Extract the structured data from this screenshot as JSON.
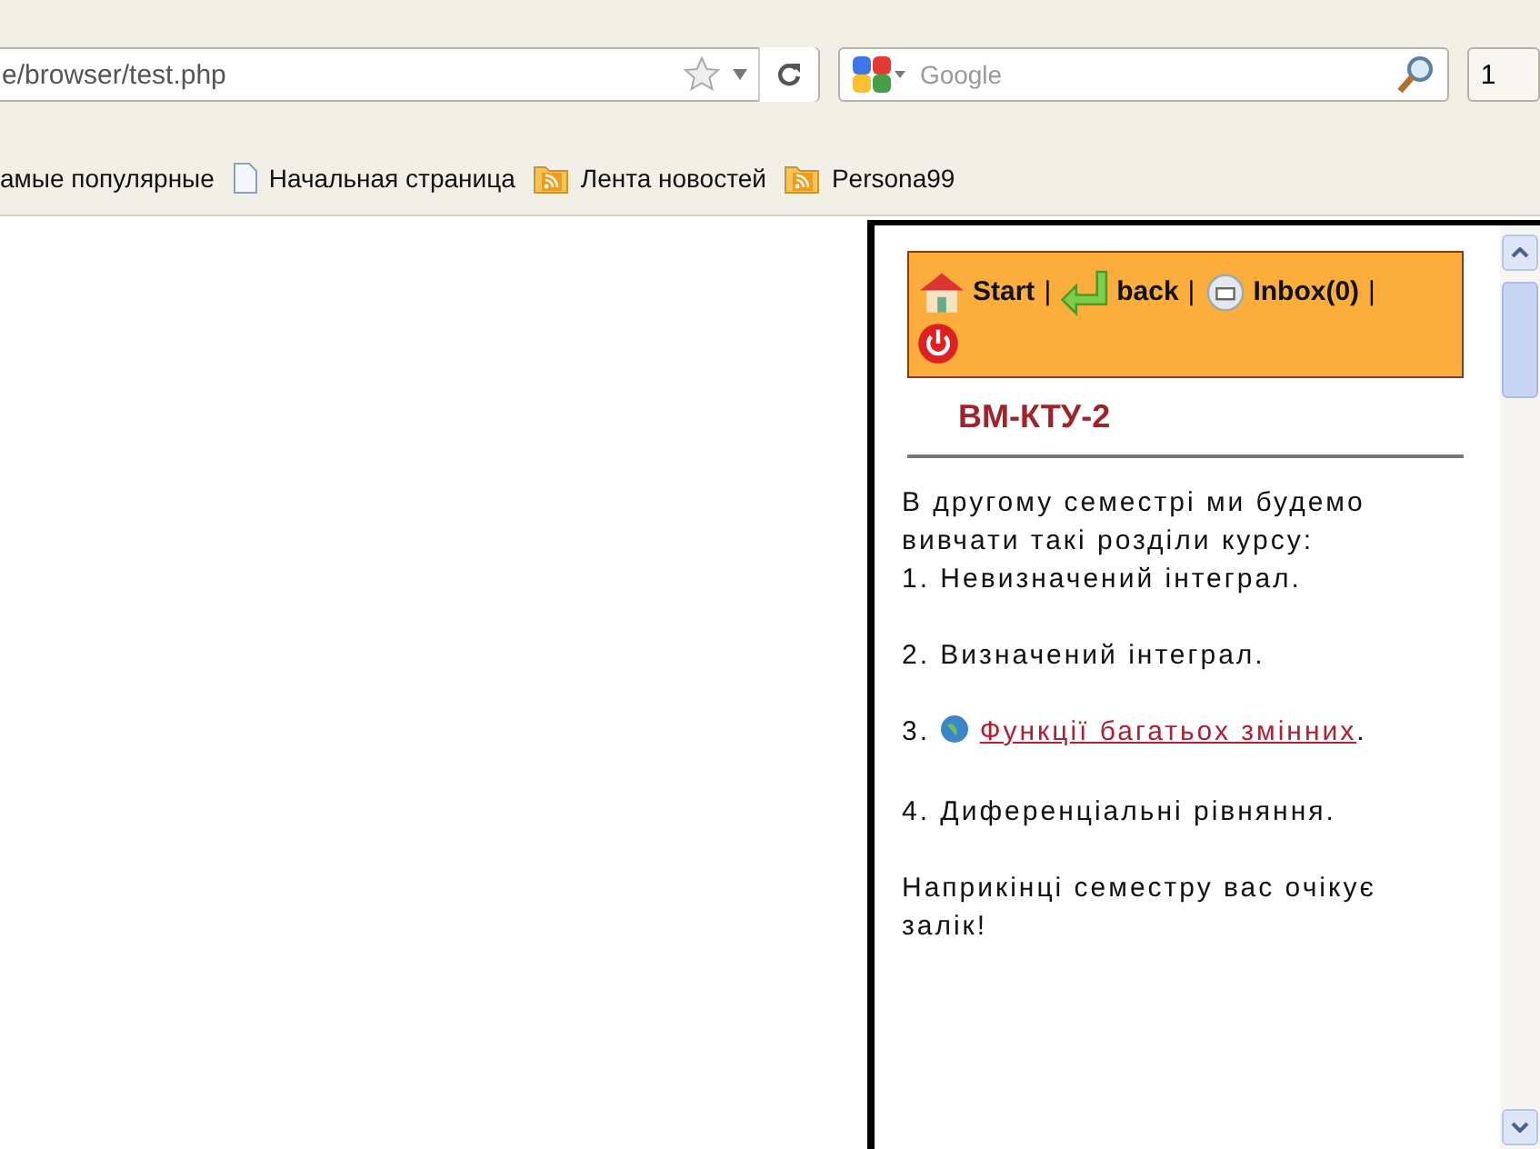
{
  "browser": {
    "address": "e/browser/test.php",
    "search": {
      "placeholder": "Google"
    },
    "toolbar_button": "1",
    "bookmarks": [
      {
        "kind": "plain",
        "label": "амые популярные"
      },
      {
        "kind": "page",
        "label": "Начальная страница"
      },
      {
        "kind": "feed",
        "label": "Лента новостей"
      },
      {
        "kind": "feed",
        "label": "Persona99"
      }
    ]
  },
  "mobile_page": {
    "nav": [
      {
        "kind": "home",
        "label": "Start",
        "separator": "|"
      },
      {
        "kind": "back",
        "label": "back",
        "separator": "|"
      },
      {
        "kind": "mail",
        "label": "Inbox(0)",
        "separator": "|"
      },
      {
        "kind": "power"
      }
    ],
    "title": "ВМ-КТУ-2",
    "blocks": [
      {
        "kind": "text",
        "lines": [
          "В другому семестрі ми будемо вивчати такі розділи курсу:",
          "1. Невизначений інтеграл."
        ]
      },
      {
        "kind": "text",
        "lines": [
          "2. Визначений інтеграл."
        ]
      },
      {
        "kind": "link",
        "prefix": "3.",
        "link": "Функції багатьох змінних",
        "suffix": "."
      },
      {
        "kind": "text",
        "lines": [
          "4. Диференціальні рівняння."
        ]
      },
      {
        "kind": "text",
        "lines": [
          "Наприкінці семестру вас очікує залік!"
        ]
      }
    ]
  }
}
